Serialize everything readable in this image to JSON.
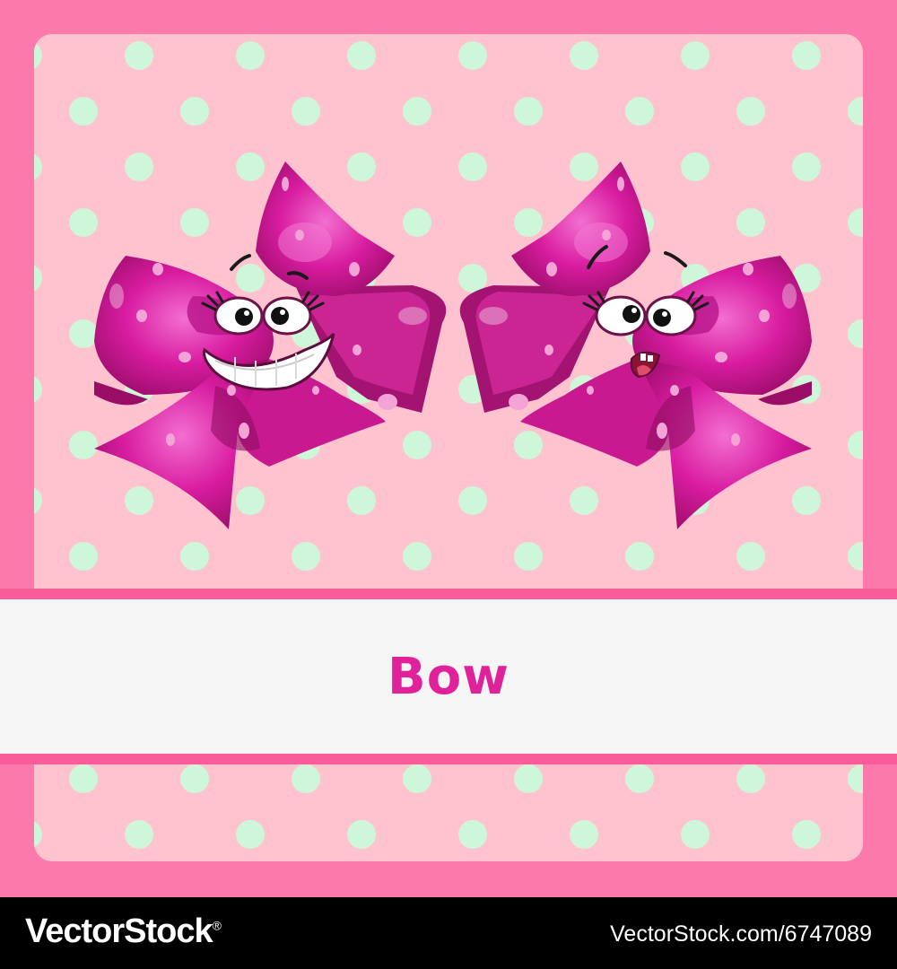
{
  "card": {
    "title": "Bow",
    "colors": {
      "frame": "#fb79ab",
      "panel": "#ffc3cf",
      "dots": "#cdf7d8",
      "band_line": "#f95d99",
      "band_fill": "#f5f5f5",
      "title_text": "#e0229a",
      "bow_main": "#d81ca0",
      "bow_light": "#e84fbf",
      "bow_dark": "#a00e6e",
      "bow_spots": "#f3a3d6"
    }
  },
  "illustration": {
    "left_bow": {
      "expression": "grinning"
    },
    "right_bow": {
      "expression": "cross-eyed-confused"
    }
  },
  "watermark": {
    "brand": "VectorStock",
    "registered_mark": "®",
    "stock_id": "VectorStock.com/6747089"
  }
}
